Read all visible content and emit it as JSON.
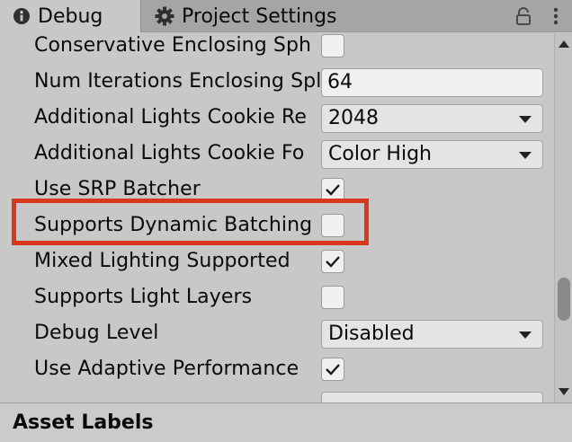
{
  "tabs": {
    "debug_label": "Debug",
    "project_settings_label": "Project Settings"
  },
  "rows": [
    {
      "label": "Conservative Enclosing Sph",
      "control": "checkbox",
      "checked": false
    },
    {
      "label": "Num Iterations Enclosing Spl",
      "control": "textfield",
      "value": "64"
    },
    {
      "label": "Additional Lights Cookie Re",
      "control": "dropdown",
      "value": "2048"
    },
    {
      "label": "Additional Lights Cookie Fo",
      "control": "dropdown",
      "value": "Color High"
    },
    {
      "label": "Use SRP Batcher",
      "control": "checkbox",
      "checked": true
    },
    {
      "label": "Supports Dynamic Batching",
      "control": "checkbox",
      "checked": false
    },
    {
      "label": "Mixed Lighting Supported",
      "control": "checkbox",
      "checked": true
    },
    {
      "label": "Supports Light Layers",
      "control": "checkbox",
      "checked": false
    },
    {
      "label": "Debug Level",
      "control": "dropdown",
      "value": "Disabled"
    },
    {
      "label": "Use Adaptive Performance",
      "control": "checkbox",
      "checked": true
    },
    {
      "label": "",
      "control": "dropdown",
      "value": ""
    }
  ],
  "highlight_color": "#d9381e",
  "footer": {
    "title": "Asset Labels"
  }
}
